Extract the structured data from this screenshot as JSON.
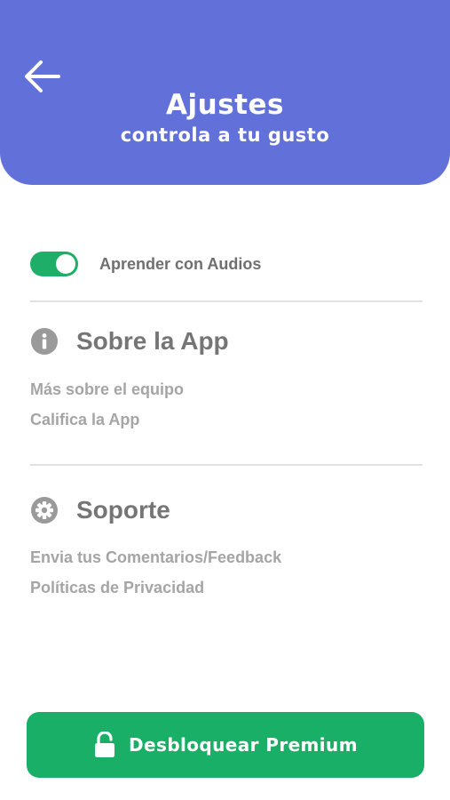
{
  "header": {
    "back_icon": "arrow-left-icon",
    "title": "Ajustes",
    "subtitle": "controla a tu gusto",
    "background_color": "#6270da"
  },
  "settings": {
    "audio_toggle": {
      "label": "Aprender con Audios",
      "enabled": true,
      "accent_color": "#1fae68"
    }
  },
  "sections": [
    {
      "icon": "info-icon",
      "title": "Sobre la App",
      "links": [
        "Más sobre el equipo",
        "Califica la App"
      ]
    },
    {
      "icon": "gear-icon",
      "title": "Soporte",
      "links": [
        "Envia tus Comentarios/Feedback",
        "Políticas de Privacidad"
      ]
    }
  ],
  "premium_button": {
    "icon": "lock-icon",
    "label": "Desbloquear Premium",
    "color": "#1aaf67"
  }
}
